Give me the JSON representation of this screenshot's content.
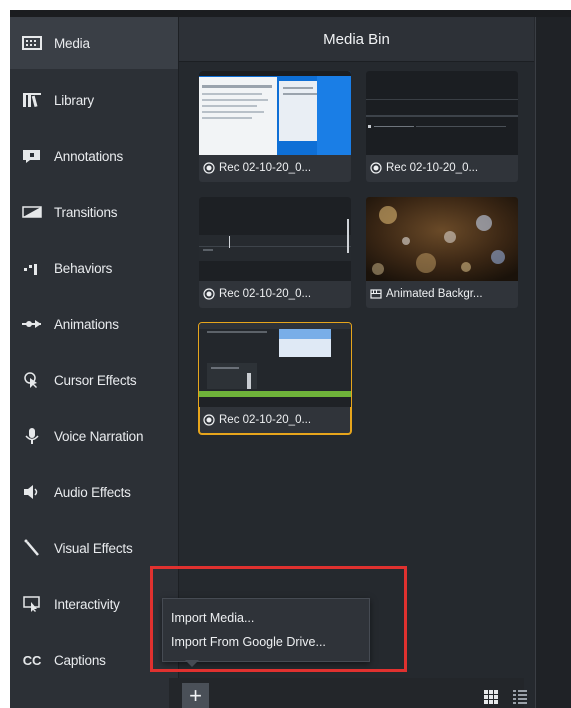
{
  "sidebar": {
    "items": [
      {
        "label": "Media",
        "icon": "film-strip-icon"
      },
      {
        "label": "Library",
        "icon": "library-books-icon"
      },
      {
        "label": "Annotations",
        "icon": "speech-bubble-icon"
      },
      {
        "label": "Transitions",
        "icon": "transition-icon"
      },
      {
        "label": "Behaviors",
        "icon": "behaviors-icon"
      },
      {
        "label": "Animations",
        "icon": "animation-arrow-icon"
      },
      {
        "label": "Cursor Effects",
        "icon": "cursor-icon"
      },
      {
        "label": "Voice Narration",
        "icon": "microphone-icon"
      },
      {
        "label": "Audio Effects",
        "icon": "speaker-icon"
      },
      {
        "label": "Visual Effects",
        "icon": "magic-wand-icon"
      },
      {
        "label": "Interactivity",
        "icon": "interactivity-icon"
      },
      {
        "label": "Captions",
        "icon": "cc-icon",
        "icon_text": "CC"
      }
    ]
  },
  "media_bin": {
    "title": "Media Bin",
    "items": [
      {
        "caption": "Rec 02-10-20_0...",
        "type": "screen-recording",
        "icon": "recording-icon"
      },
      {
        "caption": "Rec 02-10-20_0...",
        "type": "screen-recording",
        "icon": "recording-icon"
      },
      {
        "caption": "Rec 02-10-20_0...",
        "type": "screen-recording",
        "icon": "recording-icon"
      },
      {
        "caption": "Animated Backgr...",
        "type": "video",
        "icon": "video-icon"
      },
      {
        "caption": "Rec 02-10-20_0...",
        "type": "screen-recording",
        "icon": "recording-icon",
        "selected": true
      }
    ]
  },
  "import_menu": {
    "items": [
      {
        "label": "Import Media..."
      },
      {
        "label": "Import From Google Drive..."
      }
    ]
  },
  "bottom_bar": {
    "add_label": "+",
    "views": [
      "grid-view-icon",
      "list-view-icon"
    ]
  },
  "colors": {
    "selection": "#e7a51c",
    "highlight": "#e0312f",
    "panel": "#25292e",
    "sidebar": "#2c3036"
  }
}
